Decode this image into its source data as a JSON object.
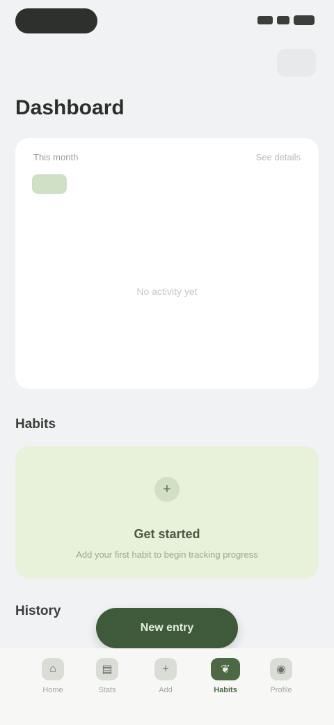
{
  "header": {
    "title": "Dashboard"
  },
  "summary_card": {
    "label": "This month",
    "link": "See details",
    "empty_text": "No activity yet"
  },
  "sections": {
    "habits_title": "Habits",
    "history_title": "History"
  },
  "promo": {
    "icon": "plus-icon",
    "title": "Get started",
    "subtitle": "Add your first habit to begin tracking progress"
  },
  "fab": {
    "label": "New entry"
  },
  "tabs": [
    {
      "label": "Home",
      "icon": "home-icon"
    },
    {
      "label": "Stats",
      "icon": "chart-icon"
    },
    {
      "label": "Add",
      "icon": "plus-icon"
    },
    {
      "label": "Habits",
      "icon": "leaf-icon",
      "active": true
    },
    {
      "label": "Profile",
      "icon": "user-icon"
    }
  ],
  "colors": {
    "accent": "#4c6845",
    "promo_bg": "#e8f2da",
    "background": "#f1f2f4"
  }
}
